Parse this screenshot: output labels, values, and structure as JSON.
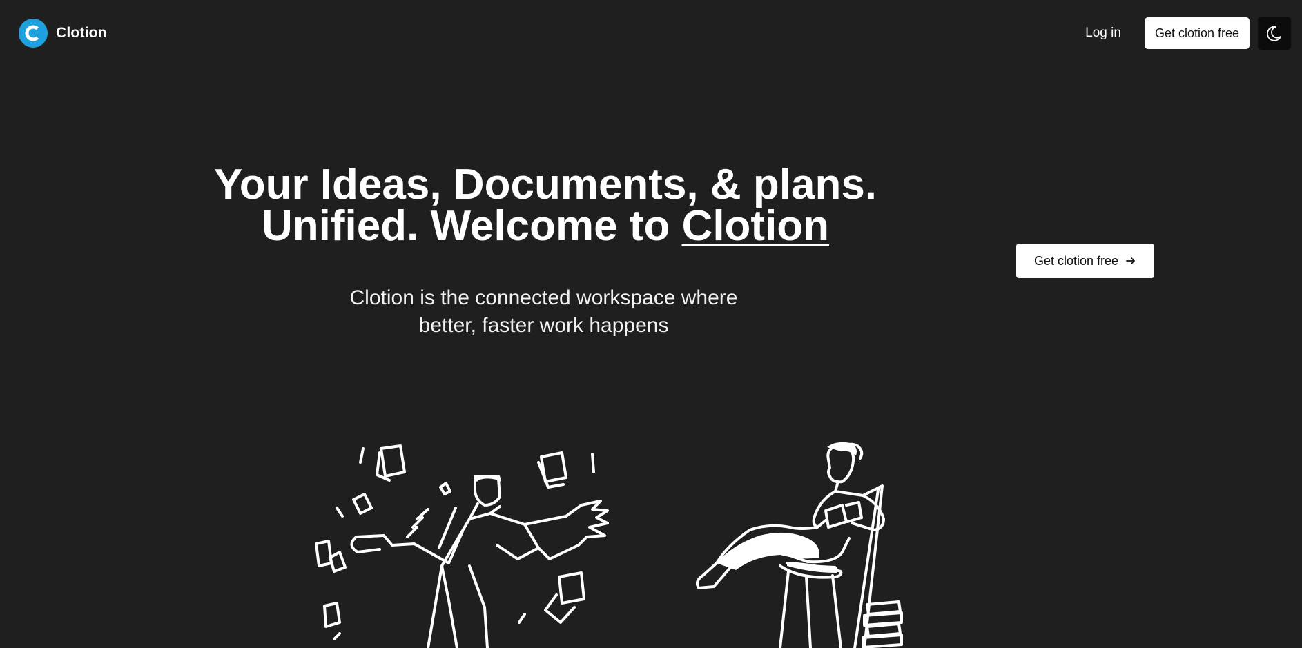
{
  "nav": {
    "brand_name": "Clotion",
    "logo_letter": "C",
    "login_label": "Log in",
    "get_free_label": "Get clotion free",
    "theme_icon": "moon-stars-icon"
  },
  "hero": {
    "title_line1": "Your Ideas, Documents, & plans.",
    "title_line2_prefix": "Unified. Welcome to ",
    "title_line2_brand": "Clotion",
    "subtitle_line1": "Clotion is the connected workspace where",
    "subtitle_line2": "better, faster work happens",
    "cta_label": "Get clotion free",
    "cta_icon": "arrow-right-icon"
  },
  "colors": {
    "background": "#1f1f1f",
    "accent_logo": "#1ea0de",
    "button_bg": "#ffffff",
    "theme_button_bg": "#0c0c0c"
  }
}
